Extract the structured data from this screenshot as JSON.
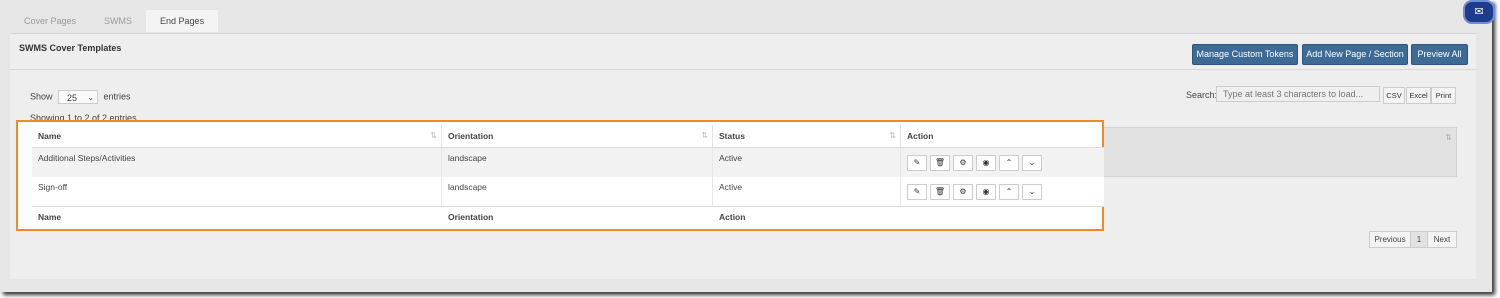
{
  "tabs": [
    "Cover Pages",
    "SWMS",
    "End Pages"
  ],
  "panel_title": "SWMS Cover Templates",
  "buttons": {
    "manage_tokens": "Manage Custom Tokens",
    "add_page": "Add New Page / Section",
    "preview_all": "Preview All"
  },
  "length": {
    "show": "Show",
    "value": "25",
    "entries": "entries"
  },
  "search": {
    "label": "Search:",
    "placeholder": "Type at least 3 characters to load..."
  },
  "export": [
    "CSV",
    "Excel",
    "Print"
  ],
  "showing": "Showing 1 to 2 of 2 entries",
  "table": {
    "headers": [
      "Name",
      "Orientation",
      "Status",
      "Action"
    ],
    "rows": [
      {
        "name": "Additional Steps/Activities",
        "orientation": "landscape",
        "status": "Active"
      },
      {
        "name": "Sign-off",
        "orientation": "landscape",
        "status": "Active"
      }
    ],
    "footer": [
      "Name",
      "Orientation",
      "Action"
    ]
  },
  "action_icons": [
    "edit-icon",
    "trash-icon",
    "gear-icon",
    "eye-icon",
    "chevron-up-icon",
    "chevron-down-icon"
  ],
  "pagination": {
    "previous": "Previous",
    "page": "1",
    "next": "Next"
  },
  "colors": {
    "primary": "#3d6b96",
    "highlight": "#f08a24"
  }
}
